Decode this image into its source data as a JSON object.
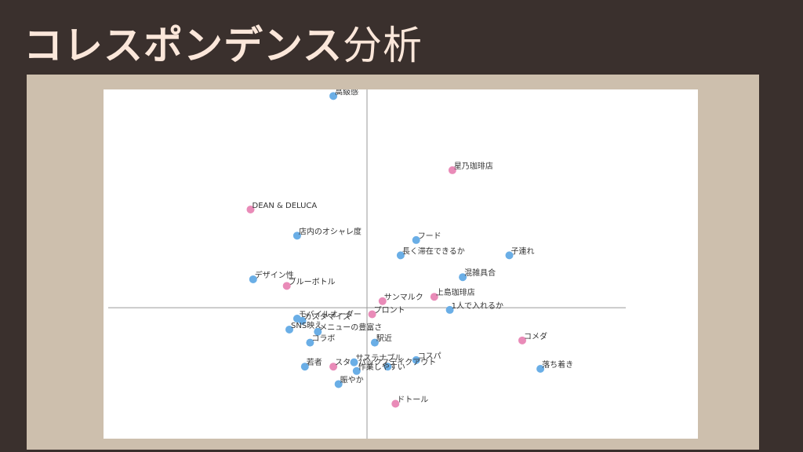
{
  "slide": {
    "title_main": "コレスポンデンス",
    "title_suffix": "分析"
  },
  "chart_data": {
    "type": "scatter",
    "title": "",
    "xlabel": "",
    "ylabel": "",
    "xlim": [
      -1.0,
      1.0
    ],
    "ylim": [
      -0.6,
      1.0
    ],
    "grid": false,
    "axes_lines_at_zero": true,
    "series": [
      {
        "color": "#e98bb8",
        "points": [
          {
            "label": "星乃珈琲店",
            "x": 0.33,
            "y": 0.63
          },
          {
            "label": "DEAN & DELUCA",
            "x": -0.45,
            "y": 0.45
          },
          {
            "label": "ブルーボトル",
            "x": -0.31,
            "y": 0.1
          },
          {
            "label": "サンマルク",
            "x": 0.06,
            "y": 0.03
          },
          {
            "label": "上島珈琲店",
            "x": 0.26,
            "y": 0.05
          },
          {
            "label": "プロント",
            "x": 0.02,
            "y": -0.03
          },
          {
            "label": "コメダ",
            "x": 0.6,
            "y": -0.15
          },
          {
            "label": "スターバックス",
            "x": -0.13,
            "y": -0.27
          },
          {
            "label": "ドトール",
            "x": 0.11,
            "y": -0.44
          }
        ]
      },
      {
        "color": "#6aaee6",
        "points": [
          {
            "label": "高級感",
            "x": -0.13,
            "y": 0.97
          },
          {
            "label": "店内のオシャレ度",
            "x": -0.27,
            "y": 0.33
          },
          {
            "label": "フード",
            "x": 0.19,
            "y": 0.31
          },
          {
            "label": "長く滞在できるか",
            "x": 0.13,
            "y": 0.24
          },
          {
            "label": "子連れ",
            "x": 0.55,
            "y": 0.24
          },
          {
            "label": "混雑具合",
            "x": 0.37,
            "y": 0.14
          },
          {
            "label": "デザイン性",
            "x": -0.44,
            "y": 0.13
          },
          {
            "label": "1人で入れるか",
            "x": 0.32,
            "y": -0.01
          },
          {
            "label": "モバイルオーダー",
            "x": -0.27,
            "y": -0.05
          },
          {
            "label": "カスタマイズ",
            "x": -0.25,
            "y": -0.06
          },
          {
            "label": "SNS映え",
            "x": -0.3,
            "y": -0.1
          },
          {
            "label": "メニューの豊富さ",
            "x": -0.19,
            "y": -0.11
          },
          {
            "label": "コラボ",
            "x": -0.22,
            "y": -0.16
          },
          {
            "label": "駅近",
            "x": 0.03,
            "y": -0.16
          },
          {
            "label": "コスパ",
            "x": 0.19,
            "y": -0.24
          },
          {
            "label": "サステナブル",
            "x": -0.05,
            "y": -0.25
          },
          {
            "label": "テイクアウト",
            "x": 0.08,
            "y": -0.27
          },
          {
            "label": "若者",
            "x": -0.24,
            "y": -0.27
          },
          {
            "label": "作業しやすい",
            "x": -0.04,
            "y": -0.29
          },
          {
            "label": "賑やか",
            "x": -0.11,
            "y": -0.35
          },
          {
            "label": "落ち着き",
            "x": 0.67,
            "y": -0.28
          }
        ]
      }
    ]
  }
}
